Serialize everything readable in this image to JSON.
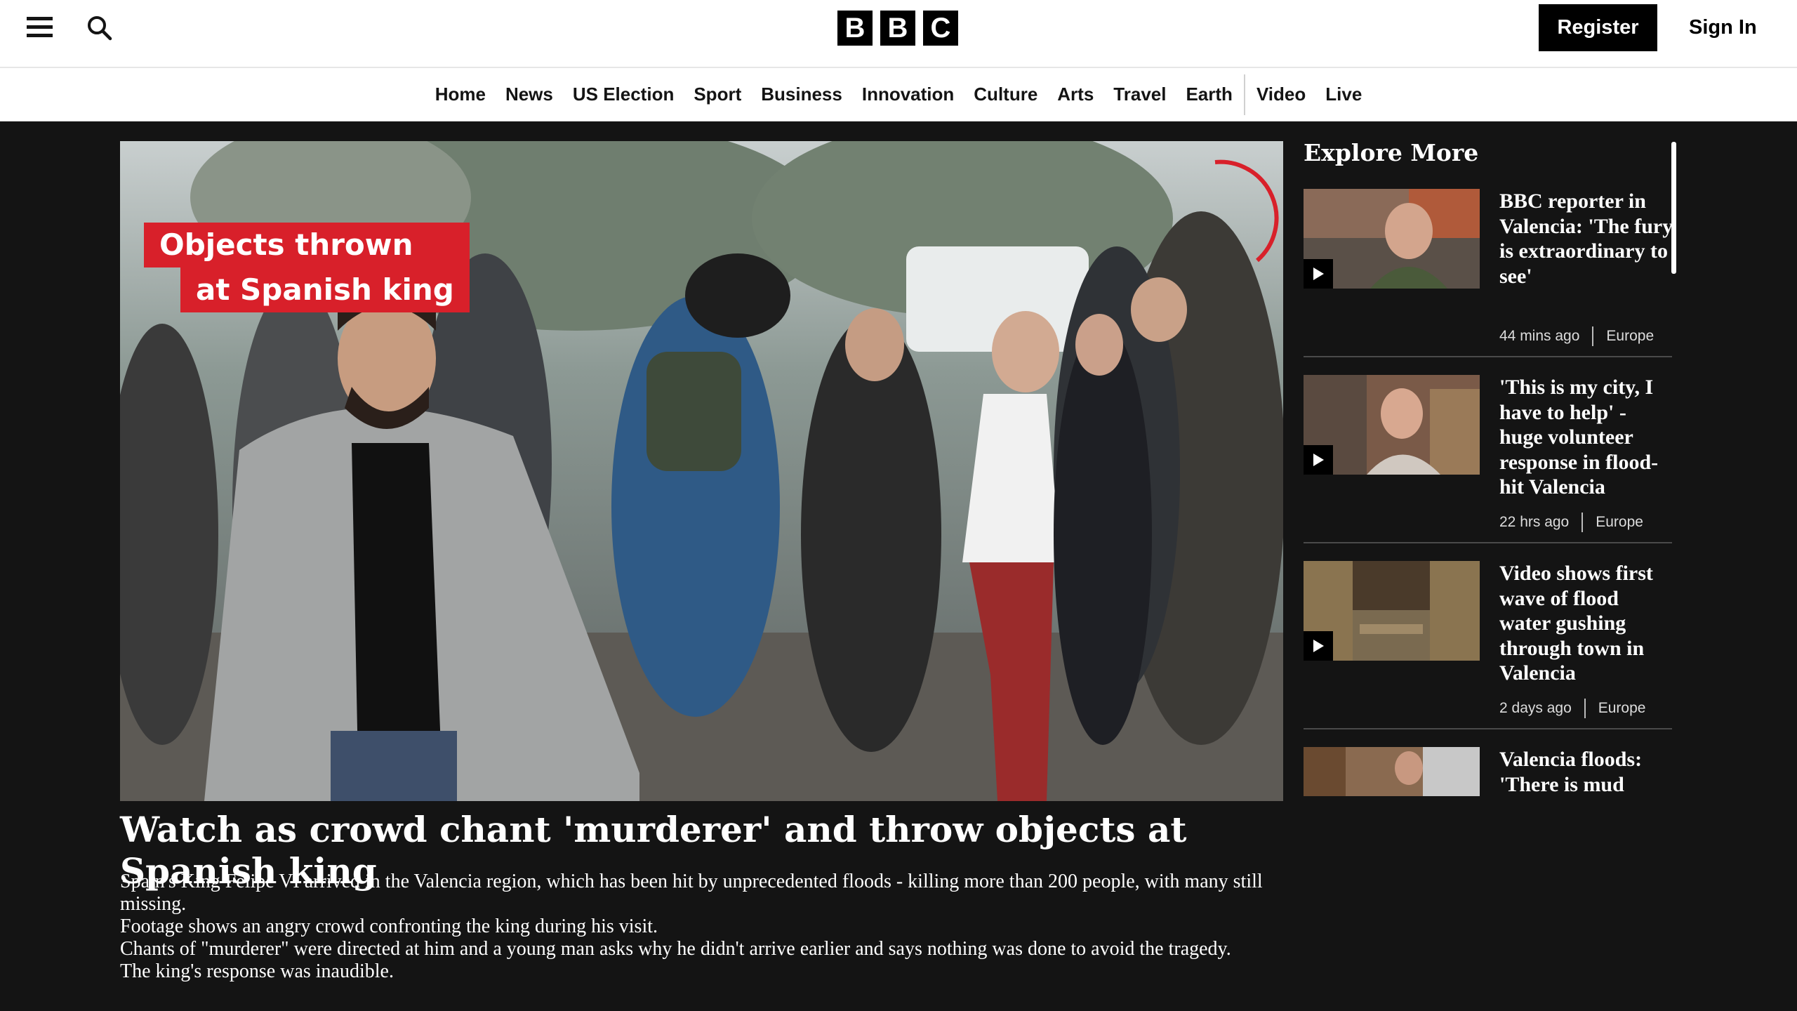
{
  "header": {
    "logo_letters": [
      "B",
      "B",
      "C"
    ],
    "register_label": "Register",
    "signin_label": "Sign In",
    "menu_icon": "hamburger-menu-icon",
    "search_icon": "search-icon"
  },
  "nav": {
    "items": [
      "Home",
      "News",
      "US Election",
      "Sport",
      "Business",
      "Innovation",
      "Culture",
      "Arts",
      "Travel",
      "Earth",
      "Video",
      "Live"
    ]
  },
  "main": {
    "video_overlay_line1": "Objects thrown",
    "video_overlay_line2": "at Spanish king",
    "headline": "Watch as crowd chant 'murderer' and throw objects at Spanish king",
    "summary": [
      "Spain's King Felipe VI arrived in the Valencia region, which has been hit by unprecedented floods - killing more than 200 people, with many still missing.",
      "Footage shows an angry crowd confronting the king during his visit.",
      "Chants of \"murderer\" were directed at him and a young man asks why he didn't arrive earlier and says nothing was done to avoid the tragedy.",
      "The king's response was inaudible."
    ]
  },
  "sidebar": {
    "title": "Explore More",
    "cards": [
      {
        "title": "BBC reporter in Valencia: 'The fury is extraordinary to see'",
        "time": "44 mins ago",
        "section": "Europe"
      },
      {
        "title": "'This is my city, I have to help' - huge volunteer response in flood-hit Valencia",
        "time": "22 hrs ago",
        "section": "Europe"
      },
      {
        "title": "Video shows first wave of flood water gushing through town in Valencia",
        "time": "2 days ago",
        "section": "Europe"
      },
      {
        "title": "Valencia floods: 'There is mud",
        "time": "",
        "section": ""
      }
    ]
  },
  "colors": {
    "page_bg": "#141414",
    "overlay_red": "#d8202a",
    "header_bg": "#ffffff"
  }
}
